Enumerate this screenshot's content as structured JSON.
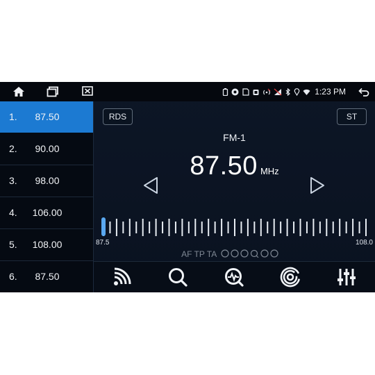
{
  "status": {
    "time": "1:23 PM"
  },
  "presets": [
    {
      "num": "1.",
      "freq": "87.50",
      "active": true
    },
    {
      "num": "2.",
      "freq": "90.00",
      "active": false
    },
    {
      "num": "3.",
      "freq": "98.00",
      "active": false
    },
    {
      "num": "4.",
      "freq": "106.00",
      "active": false
    },
    {
      "num": "5.",
      "freq": "108.00",
      "active": false
    },
    {
      "num": "6.",
      "freq": "87.50",
      "active": false
    }
  ],
  "radio": {
    "rds_label": "RDS",
    "st_label": "ST",
    "band": "FM-1",
    "frequency": "87.50",
    "unit": "MHz",
    "scale_min_label": "87.5",
    "scale_max_label": "108.0",
    "scale_min": 87.5,
    "scale_max": 108.0,
    "current": 87.5,
    "flags": "AF TP TA"
  },
  "colors": {
    "accent": "#1c7ad2",
    "background": "#0b1422"
  }
}
